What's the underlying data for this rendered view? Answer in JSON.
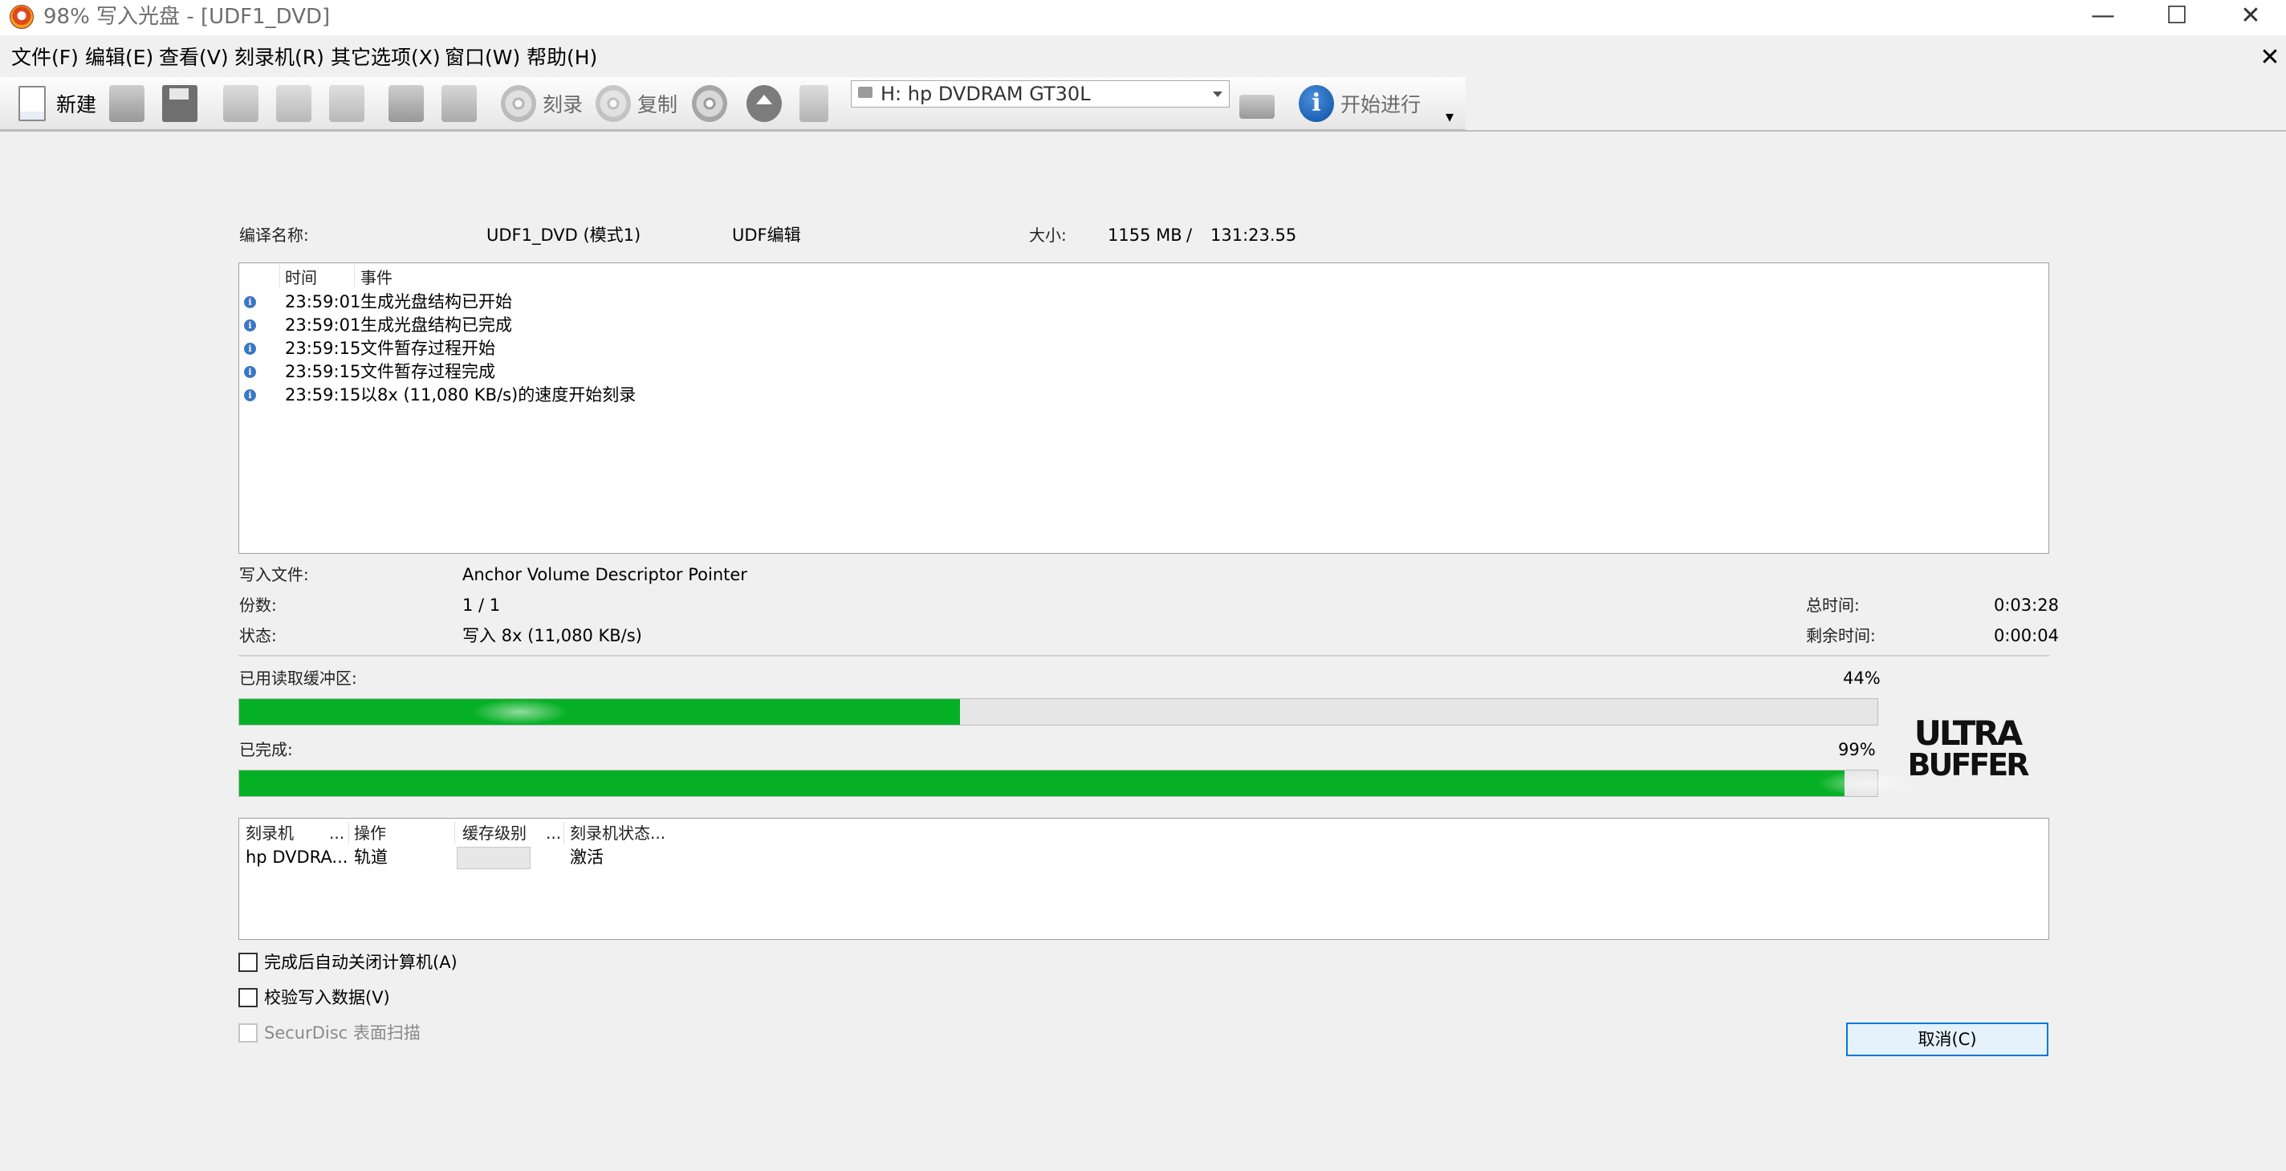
{
  "window": {
    "title": "98% 写入光盘 - [UDF1_DVD]",
    "minimize_glyph": "—",
    "maximize_glyph": "☐",
    "close_glyph": "✕"
  },
  "menu": {
    "items": [
      "文件(F)",
      "编辑(E)",
      "查看(V)",
      "刻录机(R)",
      "其它选项(X)",
      "窗口(W)",
      "帮助(H)"
    ],
    "doc_close_glyph": "✕"
  },
  "toolbar": {
    "new_label": "新建",
    "burn_label": "刻录",
    "copy_label": "复制",
    "drive_selected": "H: hp DVDRAM GT30L",
    "start_label": "开始进行",
    "overflow_glyph": "▾",
    "icons": [
      "new-document-icon",
      "edit-icon",
      "save-icon",
      "cut-icon",
      "copy-icon",
      "paste-icon",
      "library-icon",
      "tools-icon",
      "burn-icon",
      "copy-disc-icon",
      "disc-info-icon",
      "eject-icon",
      "disc-blank-icon",
      "drive-icon",
      "info-icon"
    ]
  },
  "compilation": {
    "name_label": "编译名称:",
    "name_value": "UDF1_DVD (模式1)",
    "type_value": "UDF编辑",
    "size_label": "大小:",
    "size_value": "1155 MB",
    "size_sep": "/",
    "duration_value": "131:23.55"
  },
  "log": {
    "columns": [
      "时间",
      "事件"
    ],
    "rows": [
      {
        "time": "23:59:01",
        "event": "生成光盘结构已开始"
      },
      {
        "time": "23:59:01",
        "event": "生成光盘结构已完成"
      },
      {
        "time": "23:59:15",
        "event": "文件暂存过程开始"
      },
      {
        "time": "23:59:15",
        "event": "文件暂存过程完成"
      },
      {
        "time": "23:59:15",
        "event": "以8x (11,080 KB/s)的速度开始刻录"
      }
    ]
  },
  "status": {
    "writing_file_label": "写入文件:",
    "writing_file_value": "Anchor Volume Descriptor Pointer",
    "copies_label": "份数:",
    "copies_value": "1 / 1",
    "state_label": "状态:",
    "state_value": "写入 8x (11,080 KB/s)",
    "total_time_label": "总时间:",
    "total_time_value": "0:03:28",
    "remaining_label": "剩余时间:",
    "remaining_value": "0:00:04"
  },
  "buffer": {
    "label": "已用读取缓冲区:",
    "percent_text": "44%",
    "fraction": 0.44
  },
  "completion": {
    "label": "已完成:",
    "percent_text": "99%",
    "fraction": 0.98
  },
  "logo": {
    "line1": "ULTRA",
    "line2": "BUFFER"
  },
  "drives": {
    "columns": [
      "刻录机",
      "...",
      "操作",
      "缓存级别",
      "...",
      "刻录机状态..."
    ],
    "rows": [
      {
        "recorder": "hp DVDRA...",
        "operation": "轨道",
        "status": "激活"
      }
    ]
  },
  "options": {
    "shutdown_label": "完成后自动关闭计算机(A)",
    "verify_label": "校验写入数据(V)",
    "securdisc_label": "SecurDisc 表面扫描"
  },
  "cancel_label": "取消(C)",
  "colors": {
    "progress": "#06b025",
    "accent": "#0078d7"
  }
}
